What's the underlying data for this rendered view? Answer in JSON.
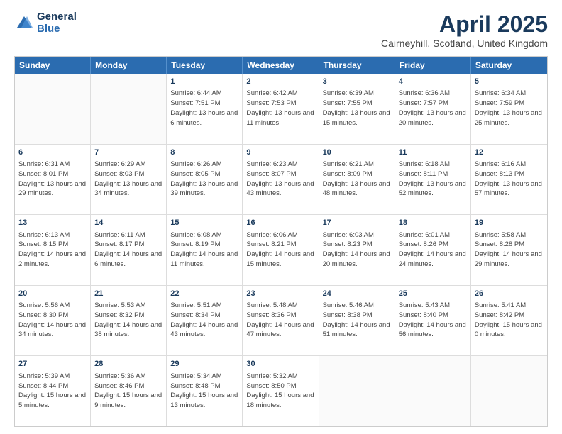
{
  "logo": {
    "general": "General",
    "blue": "Blue"
  },
  "header": {
    "title": "April 2025",
    "subtitle": "Cairneyhill, Scotland, United Kingdom"
  },
  "weekdays": [
    "Sunday",
    "Monday",
    "Tuesday",
    "Wednesday",
    "Thursday",
    "Friday",
    "Saturday"
  ],
  "weeks": [
    [
      {
        "day": "",
        "text": ""
      },
      {
        "day": "",
        "text": ""
      },
      {
        "day": "1",
        "text": "Sunrise: 6:44 AM\nSunset: 7:51 PM\nDaylight: 13 hours and 6 minutes."
      },
      {
        "day": "2",
        "text": "Sunrise: 6:42 AM\nSunset: 7:53 PM\nDaylight: 13 hours and 11 minutes."
      },
      {
        "day": "3",
        "text": "Sunrise: 6:39 AM\nSunset: 7:55 PM\nDaylight: 13 hours and 15 minutes."
      },
      {
        "day": "4",
        "text": "Sunrise: 6:36 AM\nSunset: 7:57 PM\nDaylight: 13 hours and 20 minutes."
      },
      {
        "day": "5",
        "text": "Sunrise: 6:34 AM\nSunset: 7:59 PM\nDaylight: 13 hours and 25 minutes."
      }
    ],
    [
      {
        "day": "6",
        "text": "Sunrise: 6:31 AM\nSunset: 8:01 PM\nDaylight: 13 hours and 29 minutes."
      },
      {
        "day": "7",
        "text": "Sunrise: 6:29 AM\nSunset: 8:03 PM\nDaylight: 13 hours and 34 minutes."
      },
      {
        "day": "8",
        "text": "Sunrise: 6:26 AM\nSunset: 8:05 PM\nDaylight: 13 hours and 39 minutes."
      },
      {
        "day": "9",
        "text": "Sunrise: 6:23 AM\nSunset: 8:07 PM\nDaylight: 13 hours and 43 minutes."
      },
      {
        "day": "10",
        "text": "Sunrise: 6:21 AM\nSunset: 8:09 PM\nDaylight: 13 hours and 48 minutes."
      },
      {
        "day": "11",
        "text": "Sunrise: 6:18 AM\nSunset: 8:11 PM\nDaylight: 13 hours and 52 minutes."
      },
      {
        "day": "12",
        "text": "Sunrise: 6:16 AM\nSunset: 8:13 PM\nDaylight: 13 hours and 57 minutes."
      }
    ],
    [
      {
        "day": "13",
        "text": "Sunrise: 6:13 AM\nSunset: 8:15 PM\nDaylight: 14 hours and 2 minutes."
      },
      {
        "day": "14",
        "text": "Sunrise: 6:11 AM\nSunset: 8:17 PM\nDaylight: 14 hours and 6 minutes."
      },
      {
        "day": "15",
        "text": "Sunrise: 6:08 AM\nSunset: 8:19 PM\nDaylight: 14 hours and 11 minutes."
      },
      {
        "day": "16",
        "text": "Sunrise: 6:06 AM\nSunset: 8:21 PM\nDaylight: 14 hours and 15 minutes."
      },
      {
        "day": "17",
        "text": "Sunrise: 6:03 AM\nSunset: 8:23 PM\nDaylight: 14 hours and 20 minutes."
      },
      {
        "day": "18",
        "text": "Sunrise: 6:01 AM\nSunset: 8:26 PM\nDaylight: 14 hours and 24 minutes."
      },
      {
        "day": "19",
        "text": "Sunrise: 5:58 AM\nSunset: 8:28 PM\nDaylight: 14 hours and 29 minutes."
      }
    ],
    [
      {
        "day": "20",
        "text": "Sunrise: 5:56 AM\nSunset: 8:30 PM\nDaylight: 14 hours and 34 minutes."
      },
      {
        "day": "21",
        "text": "Sunrise: 5:53 AM\nSunset: 8:32 PM\nDaylight: 14 hours and 38 minutes."
      },
      {
        "day": "22",
        "text": "Sunrise: 5:51 AM\nSunset: 8:34 PM\nDaylight: 14 hours and 43 minutes."
      },
      {
        "day": "23",
        "text": "Sunrise: 5:48 AM\nSunset: 8:36 PM\nDaylight: 14 hours and 47 minutes."
      },
      {
        "day": "24",
        "text": "Sunrise: 5:46 AM\nSunset: 8:38 PM\nDaylight: 14 hours and 51 minutes."
      },
      {
        "day": "25",
        "text": "Sunrise: 5:43 AM\nSunset: 8:40 PM\nDaylight: 14 hours and 56 minutes."
      },
      {
        "day": "26",
        "text": "Sunrise: 5:41 AM\nSunset: 8:42 PM\nDaylight: 15 hours and 0 minutes."
      }
    ],
    [
      {
        "day": "27",
        "text": "Sunrise: 5:39 AM\nSunset: 8:44 PM\nDaylight: 15 hours and 5 minutes."
      },
      {
        "day": "28",
        "text": "Sunrise: 5:36 AM\nSunset: 8:46 PM\nDaylight: 15 hours and 9 minutes."
      },
      {
        "day": "29",
        "text": "Sunrise: 5:34 AM\nSunset: 8:48 PM\nDaylight: 15 hours and 13 minutes."
      },
      {
        "day": "30",
        "text": "Sunrise: 5:32 AM\nSunset: 8:50 PM\nDaylight: 15 hours and 18 minutes."
      },
      {
        "day": "",
        "text": ""
      },
      {
        "day": "",
        "text": ""
      },
      {
        "day": "",
        "text": ""
      }
    ]
  ]
}
